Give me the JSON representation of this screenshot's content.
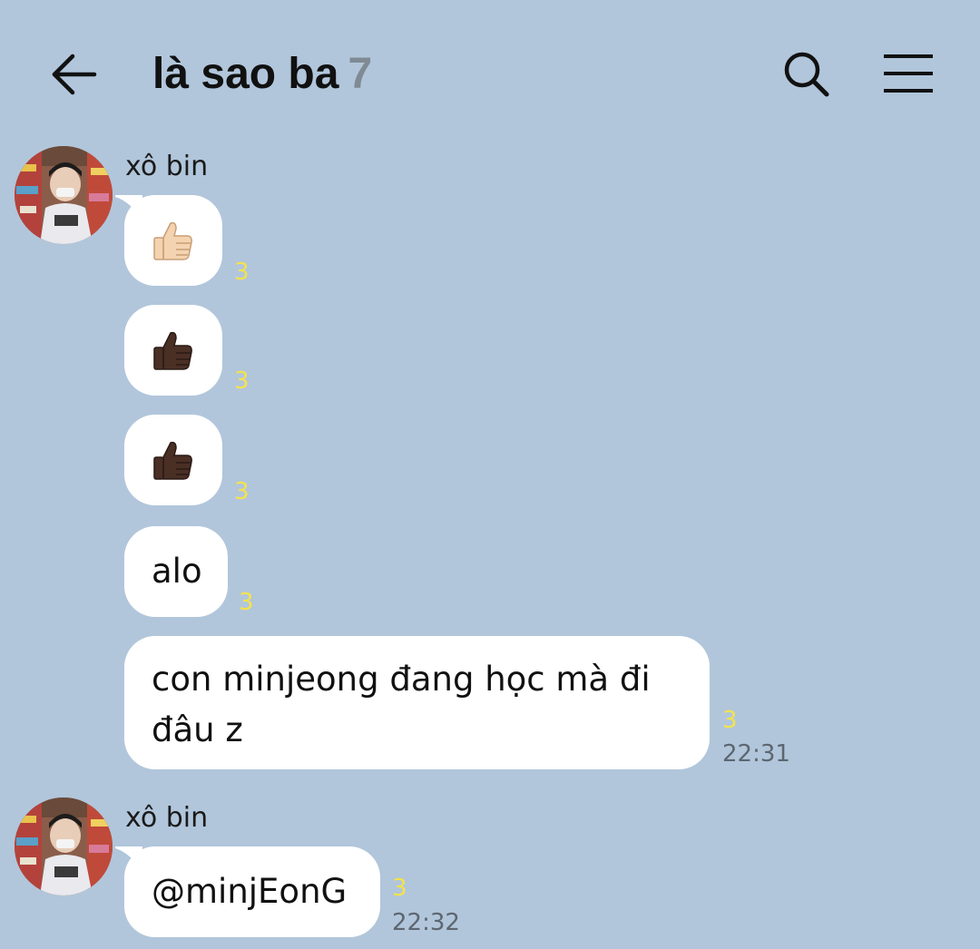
{
  "header": {
    "title": "là sao ba",
    "member_count": "7",
    "back_icon": "arrow-left-icon",
    "search_icon": "search-icon",
    "menu_icon": "hamburger-menu-icon"
  },
  "groups": [
    {
      "sender": "xô bin",
      "messages": [
        {
          "kind": "emoji",
          "emoji": "thumbs-up-light-skin-tone",
          "unread": "3"
        },
        {
          "kind": "emoji",
          "emoji": "thumbs-up-dark-skin-tone",
          "unread": "3"
        },
        {
          "kind": "emoji",
          "emoji": "thumbs-up-dark-skin-tone",
          "unread": "3"
        },
        {
          "kind": "text",
          "text": "alo",
          "unread": "3"
        },
        {
          "kind": "text",
          "text_line1": "con minjeong đang học mà đi",
          "text_line2": "đâu z",
          "unread": "3",
          "time": "22:31"
        }
      ]
    },
    {
      "sender": "xô bin",
      "messages": [
        {
          "kind": "text",
          "text": "@minjEonG",
          "unread": "3",
          "time": "22:32"
        }
      ]
    }
  ],
  "colors": {
    "background": "#b1c6db",
    "bubble": "#ffffff",
    "unread": "#f4e24d",
    "title_count": "#7f8a94"
  }
}
